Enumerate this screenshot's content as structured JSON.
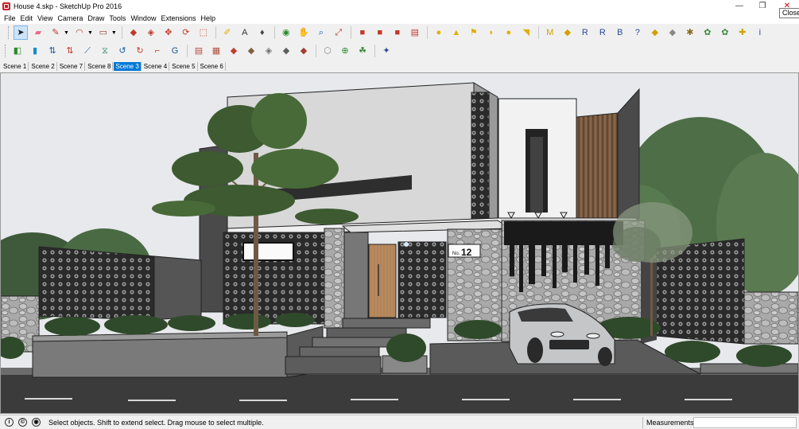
{
  "window": {
    "title": "House 4.skp - SketchUp Pro 2016",
    "close_tooltip": "Close",
    "minimize_glyph": "—",
    "maximize_glyph": "❐",
    "close_glyph": "✕"
  },
  "menu": [
    "File",
    "Edit",
    "View",
    "Camera",
    "Draw",
    "Tools",
    "Window",
    "Extensions",
    "Help"
  ],
  "toolbar_row1": [
    {
      "icon": "select-icon",
      "glyph": "➤",
      "color": "#1a1a1a",
      "active": true
    },
    {
      "icon": "eraser-icon",
      "glyph": "▰",
      "color": "#e86a8a"
    },
    {
      "icon": "pencil-icon",
      "glyph": "✎",
      "color": "#c0392b",
      "dropdown": true
    },
    {
      "icon": "arc-icon",
      "glyph": "◠",
      "color": "#c0392b",
      "dropdown": true
    },
    {
      "icon": "rectangle-icon",
      "glyph": "▭",
      "color": "#8b3a2b",
      "dropdown": true
    },
    {
      "sep": true
    },
    {
      "icon": "push-pull-icon",
      "glyph": "◆",
      "color": "#c0392b"
    },
    {
      "icon": "follow-me-icon",
      "glyph": "◈",
      "color": "#c0392b"
    },
    {
      "icon": "move-icon",
      "glyph": "✥",
      "color": "#c0392b"
    },
    {
      "icon": "rotate-icon",
      "glyph": "⟳",
      "color": "#c0392b"
    },
    {
      "icon": "scale-icon",
      "glyph": "⬚",
      "color": "#c0392b"
    },
    {
      "sep": true
    },
    {
      "icon": "tape-measure-icon",
      "glyph": "✐",
      "color": "#e0b000"
    },
    {
      "icon": "text-icon",
      "glyph": "A",
      "color": "#333"
    },
    {
      "icon": "paint-bucket-icon",
      "glyph": "♦",
      "color": "#444"
    },
    {
      "sep": true
    },
    {
      "icon": "orbit-icon",
      "glyph": "◉",
      "color": "#2a8a2a"
    },
    {
      "icon": "pan-icon",
      "glyph": "✋",
      "color": "#b07030"
    },
    {
      "icon": "zoom-icon",
      "glyph": "⌕",
      "color": "#1a5aa0"
    },
    {
      "icon": "zoom-extents-icon",
      "glyph": "⤢",
      "color": "#c0392b"
    },
    {
      "sep": true
    },
    {
      "icon": "warehouse-icon",
      "glyph": "■",
      "color": "#c0392b"
    },
    {
      "icon": "share-model-icon",
      "glyph": "■",
      "color": "#c0392b"
    },
    {
      "icon": "extension-warehouse-icon",
      "glyph": "■",
      "color": "#c0392b"
    },
    {
      "icon": "send-to-layout-icon",
      "glyph": "▤",
      "color": "#c0392b"
    },
    {
      "sep": true
    },
    {
      "icon": "sphere-icon",
      "glyph": "●",
      "color": "#e0b000"
    },
    {
      "icon": "lamp-icon",
      "glyph": "▲",
      "color": "#e0b000"
    },
    {
      "icon": "flag-icon",
      "glyph": "⚑",
      "color": "#e0b000"
    },
    {
      "icon": "dome-icon",
      "glyph": "◗",
      "color": "#e0b000"
    },
    {
      "icon": "point-light-icon",
      "glyph": "●",
      "color": "#e0b000"
    },
    {
      "icon": "spot-light-icon",
      "glyph": "◥",
      "color": "#e0b000"
    },
    {
      "sep": true
    },
    {
      "icon": "render-icon",
      "glyph": "M",
      "color": "#d4a000"
    },
    {
      "icon": "render-settings-icon",
      "glyph": "◆",
      "color": "#d4a000"
    },
    {
      "icon": "render-r-icon",
      "glyph": "R",
      "color": "#2a4a9a"
    },
    {
      "icon": "render-rt-icon",
      "glyph": "R",
      "color": "#2a4a9a"
    },
    {
      "icon": "render-batch-icon",
      "glyph": "B",
      "color": "#2a4a9a"
    },
    {
      "icon": "help-icon",
      "glyph": "?",
      "color": "#2a4a9a"
    },
    {
      "icon": "material-icon",
      "glyph": "◆",
      "color": "#d4a000"
    },
    {
      "icon": "object-icon",
      "glyph": "◆",
      "color": "#888"
    },
    {
      "icon": "proxy-icon",
      "glyph": "✱",
      "color": "#8a6a20"
    },
    {
      "icon": "scatter-icon",
      "glyph": "✿",
      "color": "#3a8a3a"
    },
    {
      "icon": "fur-icon",
      "glyph": "✿",
      "color": "#3a8a3a"
    },
    {
      "icon": "options-icon",
      "glyph": "✚",
      "color": "#d4a000"
    },
    {
      "icon": "info-icon",
      "glyph": "i",
      "color": "#2a4a9a"
    }
  ],
  "toolbar_row2": [
    {
      "icon": "section-plane-icon",
      "glyph": "◧",
      "color": "#2a8a2a"
    },
    {
      "icon": "flip-icon",
      "glyph": "▮",
      "color": "#1a8ad0"
    },
    {
      "icon": "align-icon",
      "glyph": "⇅",
      "color": "#1a5aa0"
    },
    {
      "icon": "distribute-icon",
      "glyph": "⇅",
      "color": "#c0392b"
    },
    {
      "icon": "connect-icon",
      "glyph": "⟋",
      "color": "#1a5aa0"
    },
    {
      "icon": "mirror-icon",
      "glyph": "⧖",
      "color": "#2a8a6a"
    },
    {
      "icon": "curve-icon",
      "glyph": "↺",
      "color": "#1a5aa0"
    },
    {
      "icon": "curve-reverse-icon",
      "glyph": "↻",
      "color": "#c0392b"
    },
    {
      "icon": "fillet-icon",
      "glyph": "⌐",
      "color": "#c0392b"
    },
    {
      "icon": "g3-icon",
      "glyph": "G",
      "color": "#1a5aa0"
    },
    {
      "sep": true
    },
    {
      "icon": "texture-icon",
      "glyph": "▤",
      "color": "#b05040"
    },
    {
      "icon": "uv-map-icon",
      "glyph": "▦",
      "color": "#b05040"
    },
    {
      "icon": "box-map-icon",
      "glyph": "◆",
      "color": "#c04030"
    },
    {
      "icon": "planar-map-icon",
      "glyph": "◆",
      "color": "#806040"
    },
    {
      "icon": "cylinder-map-icon",
      "glyph": "◈",
      "color": "#707070"
    },
    {
      "icon": "sphere-map-icon",
      "glyph": "◆",
      "color": "#606060"
    },
    {
      "icon": "quad-map-icon",
      "glyph": "◆",
      "color": "#a04030"
    },
    {
      "sep": true
    },
    {
      "icon": "shield-icon",
      "glyph": "⬡",
      "color": "#888"
    },
    {
      "icon": "lock-icon",
      "glyph": "⊕",
      "color": "#2a8a2a"
    },
    {
      "icon": "frog-icon",
      "glyph": "☘",
      "color": "#3a8a3a"
    },
    {
      "sep": true
    },
    {
      "icon": "plugin-icon",
      "glyph": "✦",
      "color": "#2a4a9a"
    }
  ],
  "scenes": [
    {
      "label": "Scene 1",
      "active": false
    },
    {
      "label": "Scene 2",
      "active": false
    },
    {
      "label": "Scene 7",
      "active": false
    },
    {
      "label": "Scene 8",
      "active": false
    },
    {
      "label": "Scene 3",
      "active": true
    },
    {
      "label": "Scene 4",
      "active": false
    },
    {
      "label": "Scene 5",
      "active": false
    },
    {
      "label": "Scene 6",
      "active": false
    }
  ],
  "viewport": {
    "house_number_label": "No.",
    "house_number": "12"
  },
  "status": {
    "message": "Select objects. Shift to extend select. Drag mouse to select multiple.",
    "measurements_label": "Measurements",
    "measurements_value": ""
  }
}
